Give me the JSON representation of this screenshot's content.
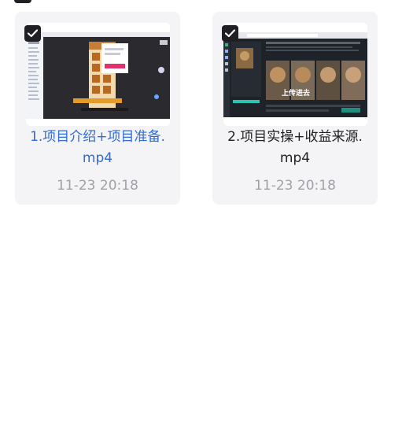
{
  "files": [
    {
      "name": "1.项目介绍+项目准备.mp4",
      "name_line1": "1.项目介绍+项目准备.",
      "name_line2": "mp4",
      "time": "11-23 20:18",
      "selected": true,
      "highlighted": true
    },
    {
      "name": "2.项目实操+收益来源.mp4",
      "name_line1": "2.项目实操+收益来源.",
      "name_line2": "mp4",
      "time": "11-23 20:18",
      "selected": true,
      "highlighted": false
    }
  ],
  "thumbnails": {
    "second_caption": "上传进去"
  },
  "colors": {
    "card_bg": "#f4f4f6",
    "highlight_text": "#2f6bd8",
    "time_text": "#a0a0a6",
    "checkbox": "#1f1f24"
  },
  "icons": {
    "checkbox": "check-icon"
  }
}
